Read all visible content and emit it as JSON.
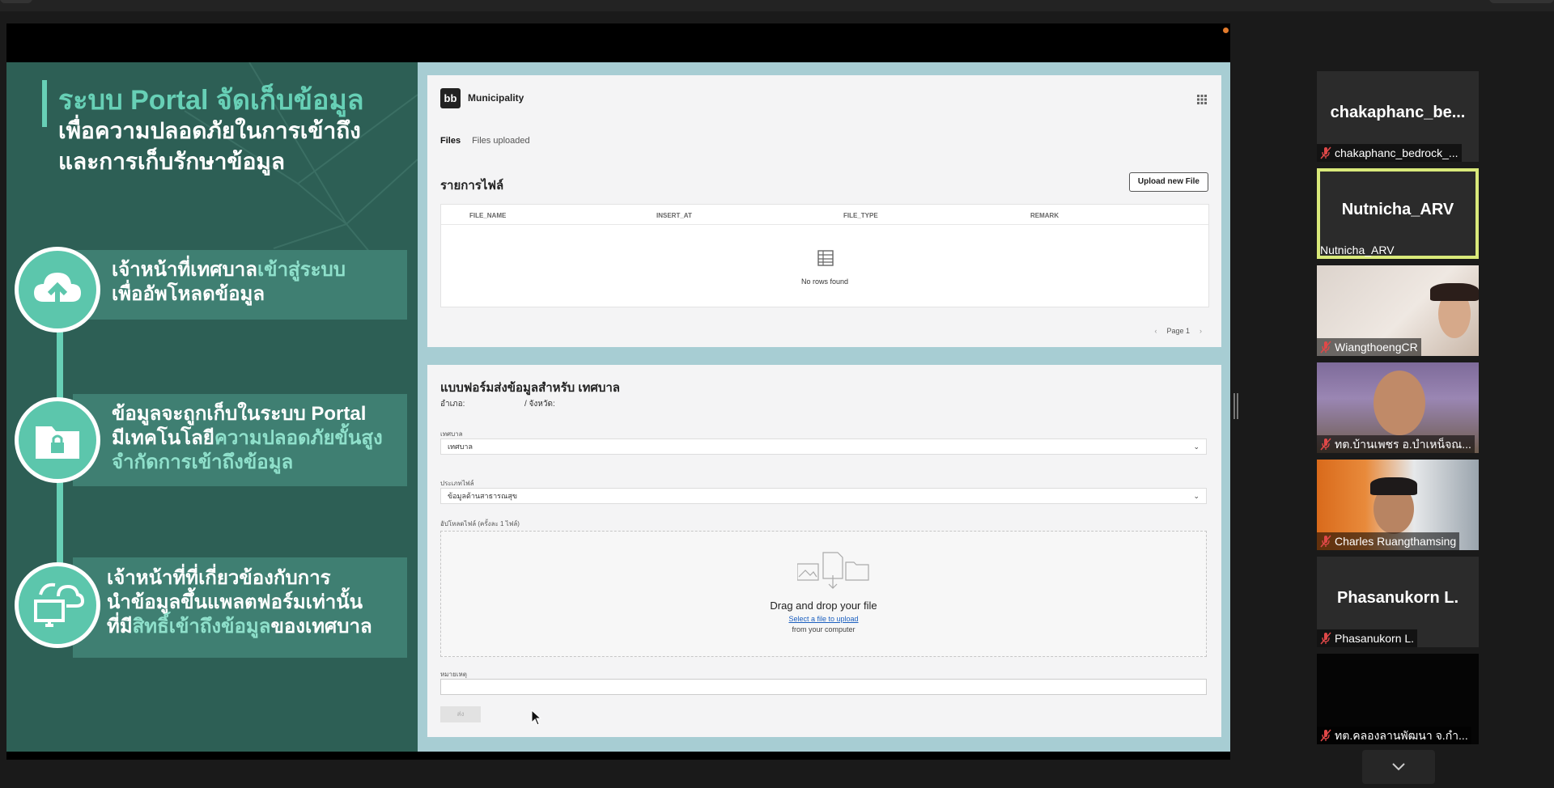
{
  "slide": {
    "title_l1": "ระบบ Portal จัดเก็บข้อมูล",
    "title_l2": "เพื่อความปลอดภัยในการเข้าถึง",
    "title_l3": "และการเก็บรักษาข้อมูล",
    "feat1_a": "เจ้าหน้าที่เทศบาล",
    "feat1_b": "เข้าสู่ระบบ",
    "feat1_c": "เพื่ออัพโหลดข้อมูล",
    "feat2_l1": "ข้อมูลจะถูกเก็บในระบบ Portal",
    "feat2_a": "มีเทคโนโลยี",
    "feat2_b": "ความปลอดภัยขั้นสูง",
    "feat2_c": "จำกัดการเข้าถึงข้อมูล",
    "feat3_a": "เจ้าหน้าที่ที่เกี่ยวข้อง",
    "feat3_b": "กับการ",
    "feat3_l2": "นำข้อมูลขึ้นแพลตฟอร์มเท่านั้น",
    "feat3_c": "ที่มี",
    "feat3_d": "สิทธิ์เข้าถึงข้อมูล",
    "feat3_e": "ของเทศบาล"
  },
  "app": {
    "brand_logo": "bb",
    "brand_name": "Municipality",
    "tabs": [
      {
        "label": "Files"
      },
      {
        "label": "Files uploaded"
      }
    ],
    "files_title": "รายการไฟล์",
    "upload_button": "Upload new File",
    "columns": [
      "FILE_NAME",
      "INSERT_AT",
      "FILE_TYPE",
      "REMARK"
    ],
    "empty_text": "No rows found",
    "page_label": "Page 1",
    "form_title": "แบบฟอร์มส่งข้อมูลสำหรับ เทศบาล",
    "amphoe_label": "อำเภอ:",
    "province_label": "/ จังหวัด:",
    "muni_label": "เทศบาล",
    "muni_value": "เทศบาล",
    "filetype_label": "ประเภทไฟล์",
    "filetype_value": "ข้อมูลด้านสาธารณสุข",
    "upload_label": "อัปโหลดไฟล์ (ครั้งละ 1 ไฟล์)",
    "dz_title": "Drag and drop your file",
    "dz_link": "Select a file to upload",
    "dz_sub": "from your computer",
    "note_label": "หมายเหตุ",
    "submit": "ส่ง"
  },
  "participants": [
    {
      "big": "chakaphanc_be...",
      "label": "chakaphanc_bedrock_..."
    },
    {
      "big": "Nutnicha_ARV",
      "label": "Nutnicha_ARV"
    },
    {
      "label": "WiangthoengCR"
    },
    {
      "label": "ทต.บ้านเพชร อ.บำเหน็จณ..."
    },
    {
      "label": "Charles Ruangthamsing"
    },
    {
      "big": "Phasanukorn L.",
      "label": "Phasanukorn L."
    },
    {
      "label": "ทต.คลองลานพัฒนา จ.กำ..."
    }
  ],
  "colors": {
    "slide_bg": "#2d5f55",
    "accent": "#67d0b6",
    "app_bg": "#a7cdd3",
    "active_speaker": "#d9e97a"
  }
}
